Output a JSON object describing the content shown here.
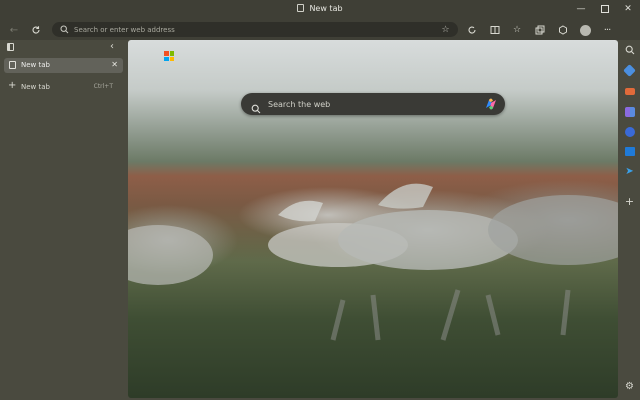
{
  "window": {
    "title": "New tab",
    "controls": [
      "minimize-icon",
      "maximize-icon",
      "close-icon"
    ]
  },
  "toolbar": {
    "address_placeholder": "Search or enter web address",
    "icons": [
      "back-icon",
      "refresh-icon",
      "search-icon",
      "favorite-star-icon",
      "browser-essentials-icon",
      "split-screen-icon",
      "favorites-icon",
      "collections-icon",
      "performance-icon",
      "profile-icon",
      "more-icon"
    ]
  },
  "sidebar": {
    "tabs": [
      {
        "label": "New tab",
        "active": true
      }
    ],
    "new_tab_label": "New tab",
    "new_tab_shortcut": "Ctrl+T"
  },
  "newtab_page": {
    "search_placeholder": "Search the web",
    "background": "white-horses-running-photo"
  },
  "colors": {
    "chrome_bg": "#4a4a3f",
    "titlebar_bg": "#3f3f36",
    "address_bg": "#2f2f29",
    "search_bg": "#3a3a36",
    "ms_red": "#f25022",
    "ms_green": "#7fba00",
    "ms_blue": "#00a4ef",
    "ms_yellow": "#ffb900"
  }
}
